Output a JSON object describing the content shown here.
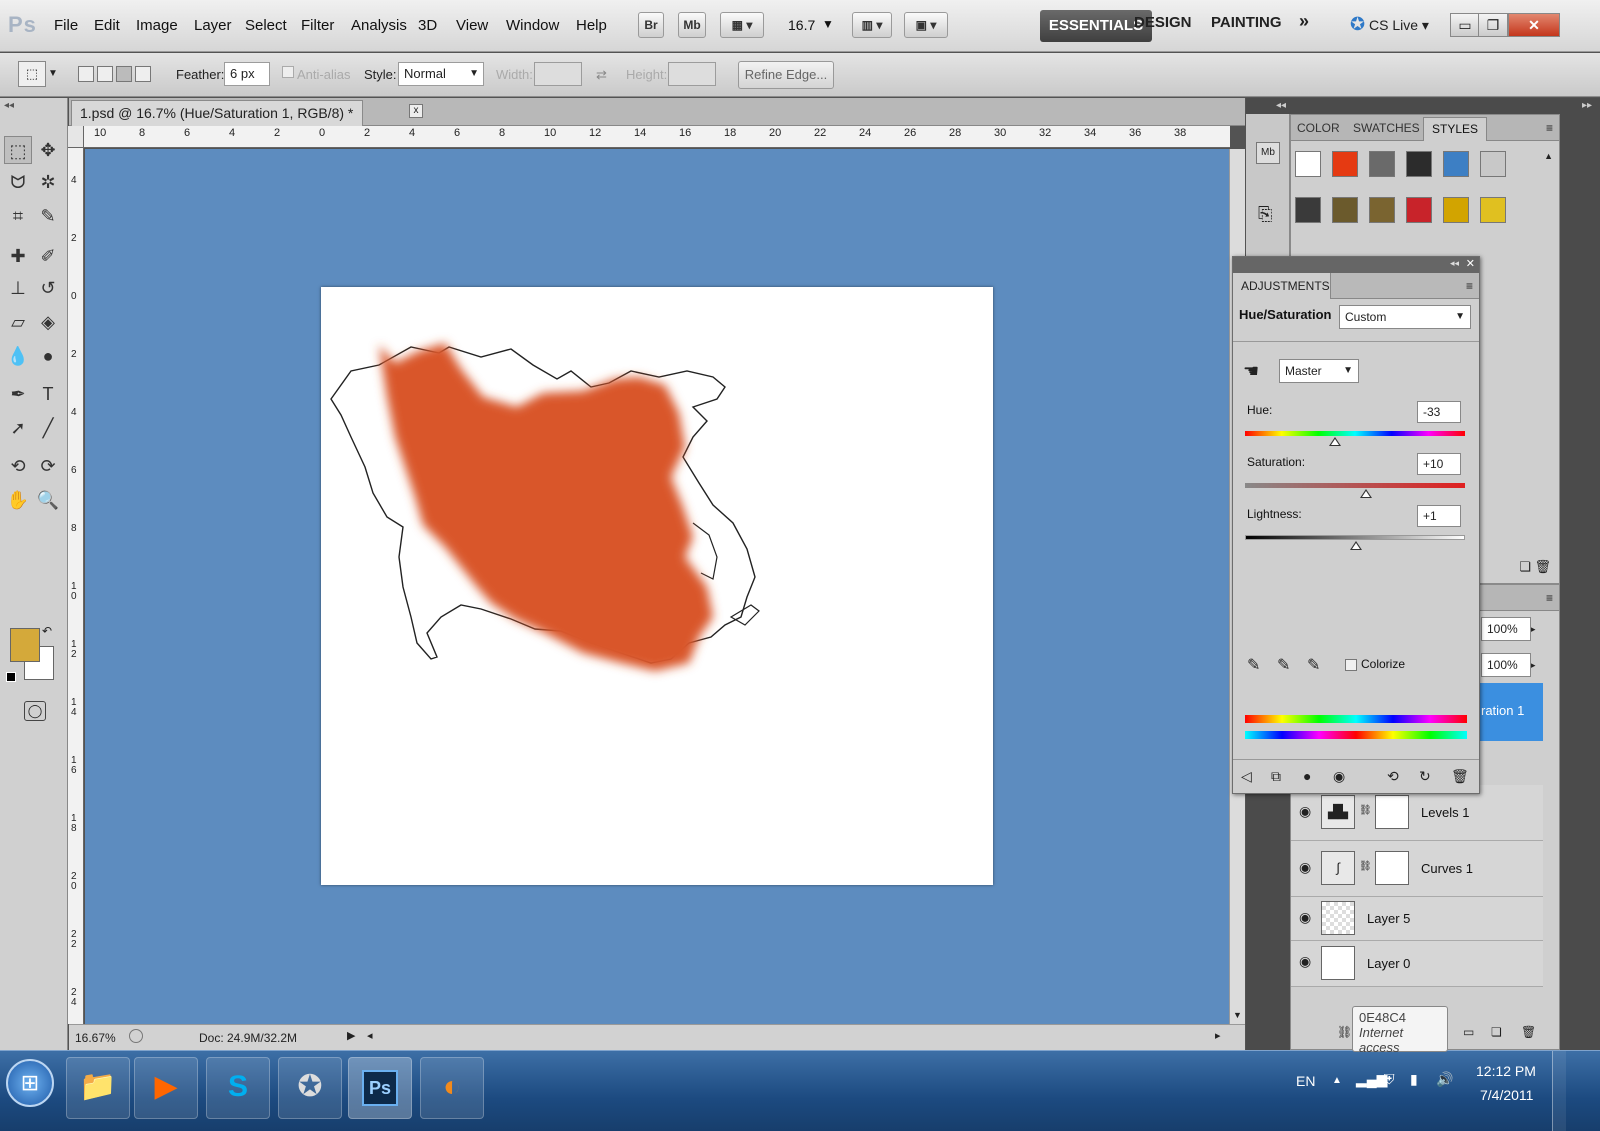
{
  "app": {
    "logo": "Ps",
    "menu": [
      "File",
      "Edit",
      "Image",
      "Layer",
      "Select",
      "Filter",
      "Analysis",
      "3D",
      "View",
      "Window",
      "Help"
    ],
    "bridge_label": "Br",
    "minibridge_label": "Mb",
    "zoom_value": "16.7",
    "workspaces": [
      "ESSENTIALS",
      "DESIGN",
      "PAINTING"
    ],
    "more_label": "»",
    "cs_live": "CS Live"
  },
  "options": {
    "feather_label": "Feather:",
    "feather_value": "6 px",
    "antialias_label": "Anti-alias",
    "style_label": "Style:",
    "style_value": "Normal",
    "width_label": "Width:",
    "height_label": "Height:",
    "refine_label": "Refine Edge..."
  },
  "document": {
    "tab_title": "1.psd @ 16.7% (Hue/Saturation 1, RGB/8) *",
    "close": "x",
    "h_ruler": [
      "10",
      "8",
      "6",
      "4",
      "2",
      "0",
      "2",
      "4",
      "6",
      "8",
      "10",
      "12",
      "14",
      "16",
      "18",
      "20",
      "22",
      "24",
      "26",
      "28",
      "30",
      "32",
      "34",
      "36",
      "38"
    ],
    "v_ruler": [
      "4",
      "2",
      "0",
      "2",
      "4",
      "6",
      "8",
      "10",
      "12",
      "14",
      "16",
      "18",
      "20",
      "22",
      "24"
    ],
    "zoom_status": "16.67%",
    "doc_info": "Doc: 24.9M/32.2M"
  },
  "panels": {
    "tabs": [
      "COLOR",
      "SWATCHES",
      "STYLES"
    ],
    "style_swatches": [
      "#ffffff",
      "#e53a12",
      "#6a6a6a",
      "#2c2c2c",
      "#3d7fc4",
      "#c8c8c8",
      "#3a3a3a",
      "#6b5a2c",
      "#7a6430",
      "#c8232a",
      "#d2a400",
      "#e0c020"
    ]
  },
  "adjustments": {
    "tab": "ADJUSTMENTS",
    "title": "Hue/Saturation",
    "preset": "Custom",
    "channel": "Master",
    "hue_label": "Hue:",
    "hue_value": "-33",
    "hue_level": -33,
    "sat_label": "Saturation:",
    "sat_value": "+10",
    "sat_level": 10,
    "light_label": "Lightness:",
    "light_value": "+1",
    "light_level": 1,
    "colorize_label": "Colorize"
  },
  "layers": {
    "opacity": "100%",
    "fill": "100%",
    "selected_partial": "ration 1",
    "items": [
      {
        "name": "Levels 1"
      },
      {
        "name": "Curves 1"
      },
      {
        "name": "Layer 5"
      },
      {
        "name": "Layer 0"
      }
    ]
  },
  "tooltip": {
    "title": "0E48C4",
    "subtitle": "Internet access"
  },
  "taskbar": {
    "lang": "EN",
    "time": "12:12 PM",
    "date": "7/4/2011"
  }
}
